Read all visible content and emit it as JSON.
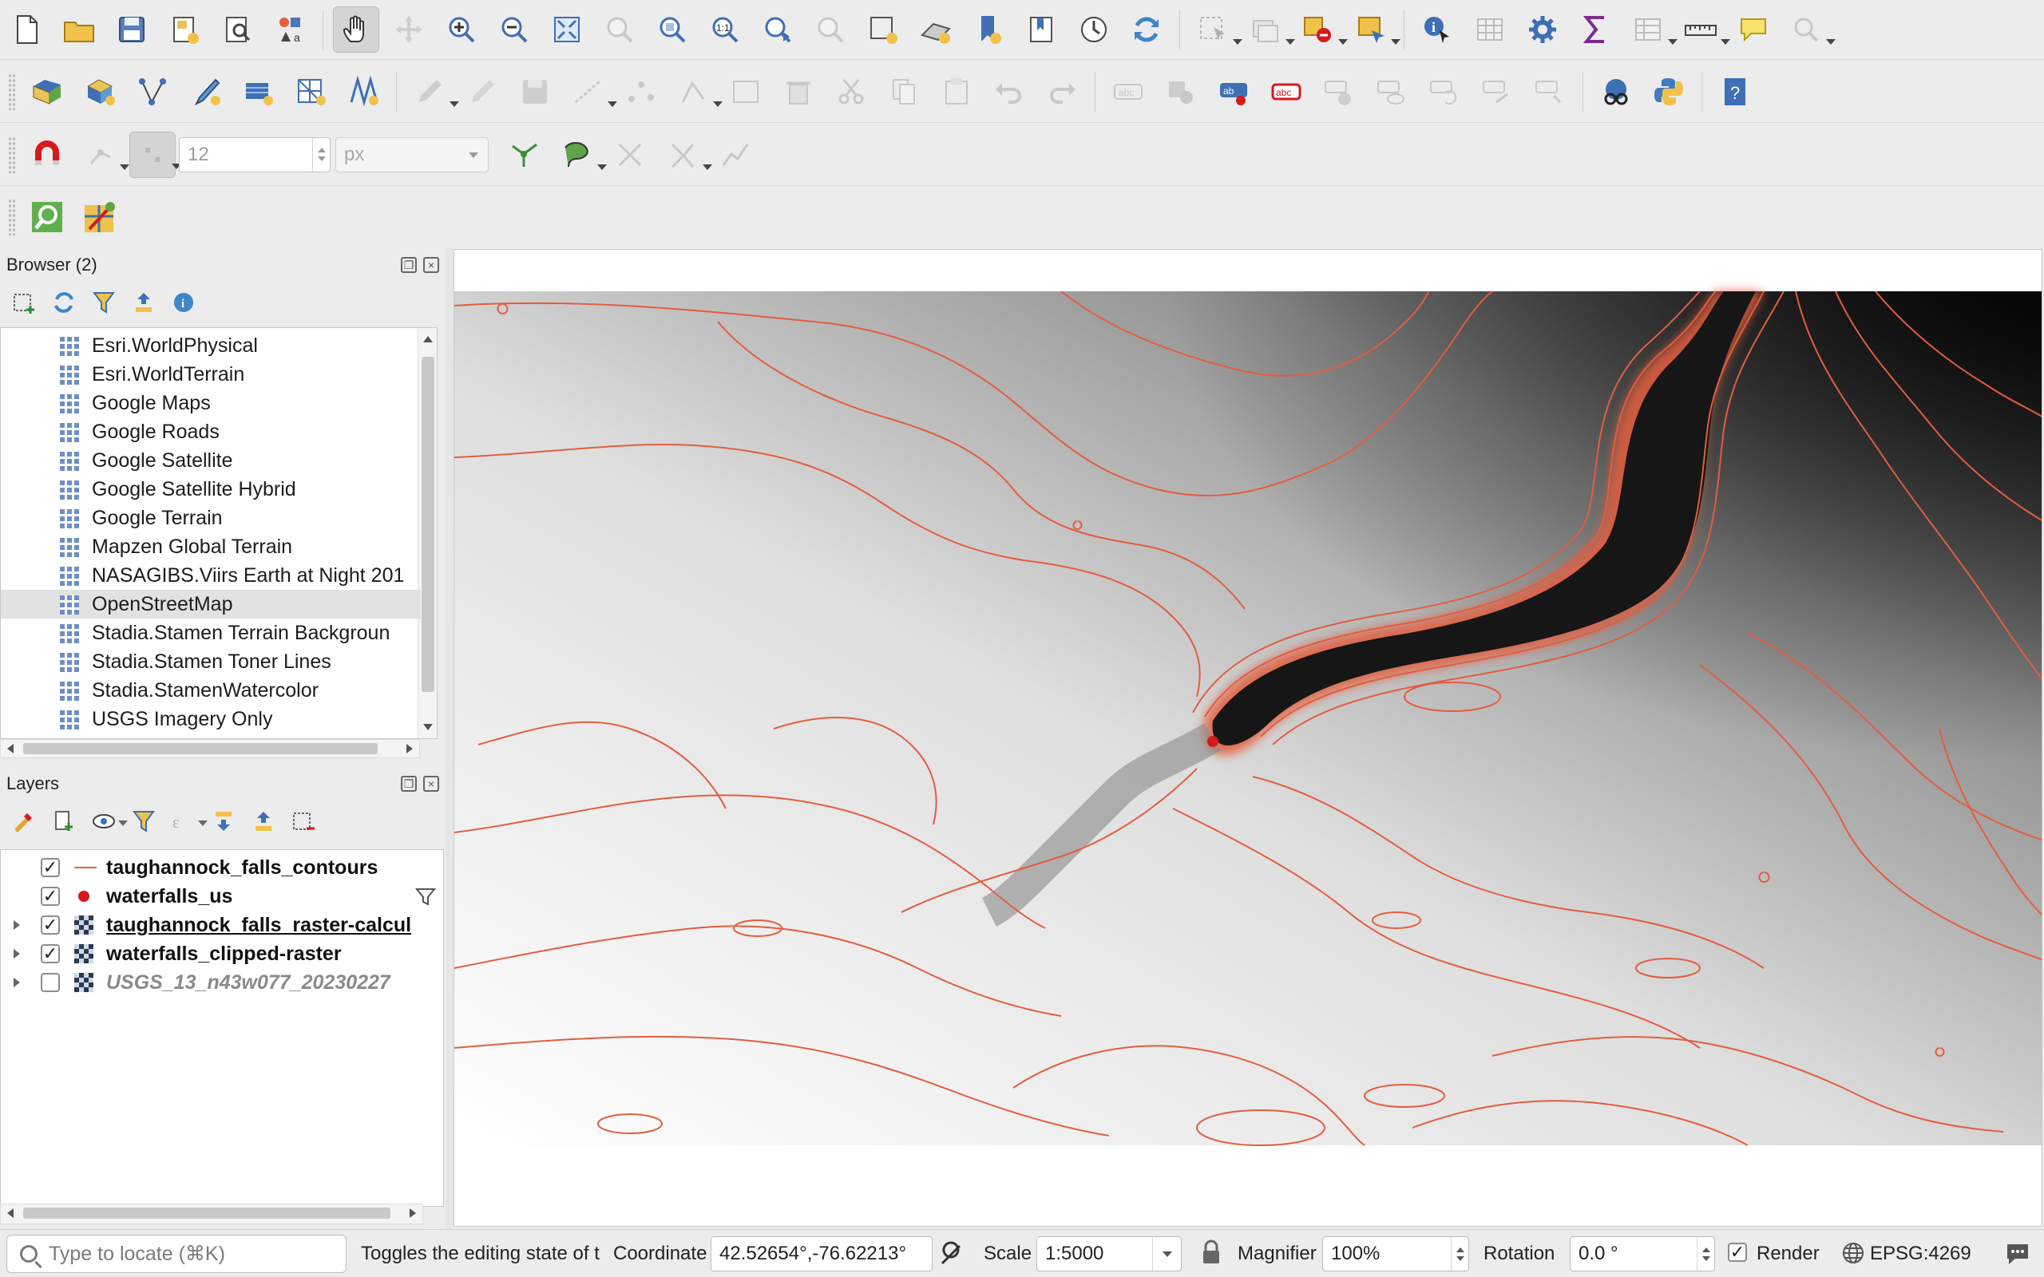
{
  "toolbar": {
    "row1": [
      "new-project",
      "open-project",
      "save-project",
      "new-print-layout",
      "layout-manager",
      "style-manager",
      "pan-map",
      "pan-to-selection",
      "zoom-in",
      "zoom-out",
      "zoom-full",
      "zoom-to-selection",
      "zoom-to-layer",
      "zoom-native",
      "zoom-last",
      "zoom-next",
      "new-map-view",
      "new-3d-view",
      "new-bookmark",
      "show-bookmarks",
      "temporal-controller",
      "refresh",
      "select-features",
      "deselect",
      "select-by-location",
      "select-by-value",
      "identify-features",
      "attribute-table",
      "processing-toolbox",
      "statistical-summary",
      "open-field-calculator",
      "measure-line",
      "map-tips",
      "lock-extent"
    ],
    "row2": [
      "data-source-manager",
      "new-geopackage-layer",
      "new-shapefile-layer",
      "new-temporary-scratch-layer",
      "new-virtual-layer",
      "new-spatialite-layer",
      "new-mesh-layer",
      "edit-toggle",
      "digitize",
      "save-edits",
      "add-line",
      "vertex-tool",
      "modify-attributes",
      "delete-selected",
      "cut-features",
      "copy-features",
      "paste-features",
      "undo",
      "redo",
      "label-tool",
      "pin-labels",
      "show-labels",
      "label-highlight",
      "move-label",
      "show-hide-labels",
      "rotate-label",
      "change-label",
      "python-console",
      "help"
    ],
    "snap_tolerance": "12",
    "snap_units": "px"
  },
  "browser": {
    "title": "Browser (2)",
    "items": [
      {
        "label": "Esri.WorldPhysical"
      },
      {
        "label": "Esri.WorldTerrain"
      },
      {
        "label": "Google Maps"
      },
      {
        "label": "Google Roads"
      },
      {
        "label": "Google Satellite"
      },
      {
        "label": "Google Satellite Hybrid"
      },
      {
        "label": "Google Terrain"
      },
      {
        "label": "Mapzen Global Terrain"
      },
      {
        "label": "NASAGIBS.Viirs Earth at Night 201"
      },
      {
        "label": "OpenStreetMap",
        "selected": true
      },
      {
        "label": "Stadia.Stamen Terrain Backgroun"
      },
      {
        "label": "Stadia.Stamen Toner Lines"
      },
      {
        "label": "Stadia.StamenWatercolor"
      },
      {
        "label": "USGS Imagery Only"
      }
    ]
  },
  "layers": {
    "title": "Layers",
    "items": [
      {
        "name": "taughannock_falls_contours",
        "checked": true,
        "symbol": "line"
      },
      {
        "name": "waterfalls_us",
        "checked": true,
        "symbol": "point",
        "filtered": true
      },
      {
        "name": "taughannock_falls_raster-calcul",
        "checked": true,
        "symbol": "raster",
        "active": true
      },
      {
        "name": "waterfalls_clipped-raster",
        "checked": true,
        "symbol": "raster"
      },
      {
        "name": "USGS_13_n43w077_20230227",
        "checked": false,
        "symbol": "raster"
      }
    ]
  },
  "status": {
    "locator_placeholder": "Type to locate (⌘K)",
    "message": "Toggles the editing state of t",
    "coordinate_label": "Coordinate",
    "coordinate_value": "42.52654°,-76.62213°",
    "scale_label": "Scale",
    "scale_value": "1:5000",
    "magnifier_label": "Magnifier",
    "magnifier_value": "100%",
    "rotation_label": "Rotation",
    "rotation_value": "0.0 °",
    "render_label": "Render",
    "crs": "EPSG:4269"
  },
  "colors": {
    "contour": "#e35d3e",
    "waterfall_point": "#d7191c",
    "accent": "#6d8fc6"
  }
}
